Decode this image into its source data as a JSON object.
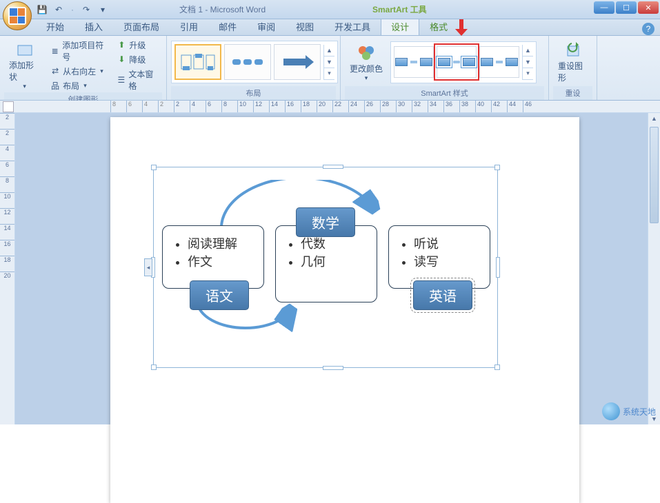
{
  "title": {
    "document": "文档 1 - Microsoft Word",
    "context_tool": "SmartArt 工具"
  },
  "qat": {
    "save": "保存",
    "undo": "撤销",
    "redo": "重做"
  },
  "tabs": {
    "items": [
      "开始",
      "插入",
      "页面布局",
      "引用",
      "邮件",
      "审阅",
      "视图",
      "开发工具"
    ],
    "context": [
      "设计",
      "格式"
    ],
    "active": "设计"
  },
  "ribbon": {
    "group_create": {
      "label": "创建图形",
      "add_shape": "添加形状",
      "add_bullet": "添加项目符号",
      "right_to_left": "从右向左",
      "layout": "布局",
      "promote": "升级",
      "demote": "降级",
      "text_pane": "文本窗格"
    },
    "group_layout": {
      "label": "布局"
    },
    "group_colors": {
      "label": "更改颜色"
    },
    "group_styles": {
      "label": "SmartArt 样式"
    },
    "group_reset": {
      "label": "重设",
      "reset_graphic": "重设图形"
    }
  },
  "ruler": {
    "h_values": [
      "8",
      "6",
      "4",
      "2",
      "2",
      "4",
      "6",
      "8",
      "10",
      "12",
      "14",
      "16",
      "18",
      "20",
      "22",
      "24",
      "26",
      "28",
      "30",
      "32",
      "34",
      "36",
      "38",
      "40",
      "42",
      "44",
      "46"
    ],
    "v_values": [
      "2",
      "2",
      "4",
      "6",
      "8",
      "10",
      "12",
      "14",
      "16",
      "18",
      "20"
    ]
  },
  "smartart": {
    "box1": {
      "title": "语文",
      "items": [
        "阅读理解",
        "作文"
      ]
    },
    "box2": {
      "title": "数学",
      "items": [
        "代数",
        "几何"
      ]
    },
    "box3": {
      "title": "英语",
      "items": [
        "听说",
        "读写"
      ]
    }
  },
  "watermark": "系统天地"
}
